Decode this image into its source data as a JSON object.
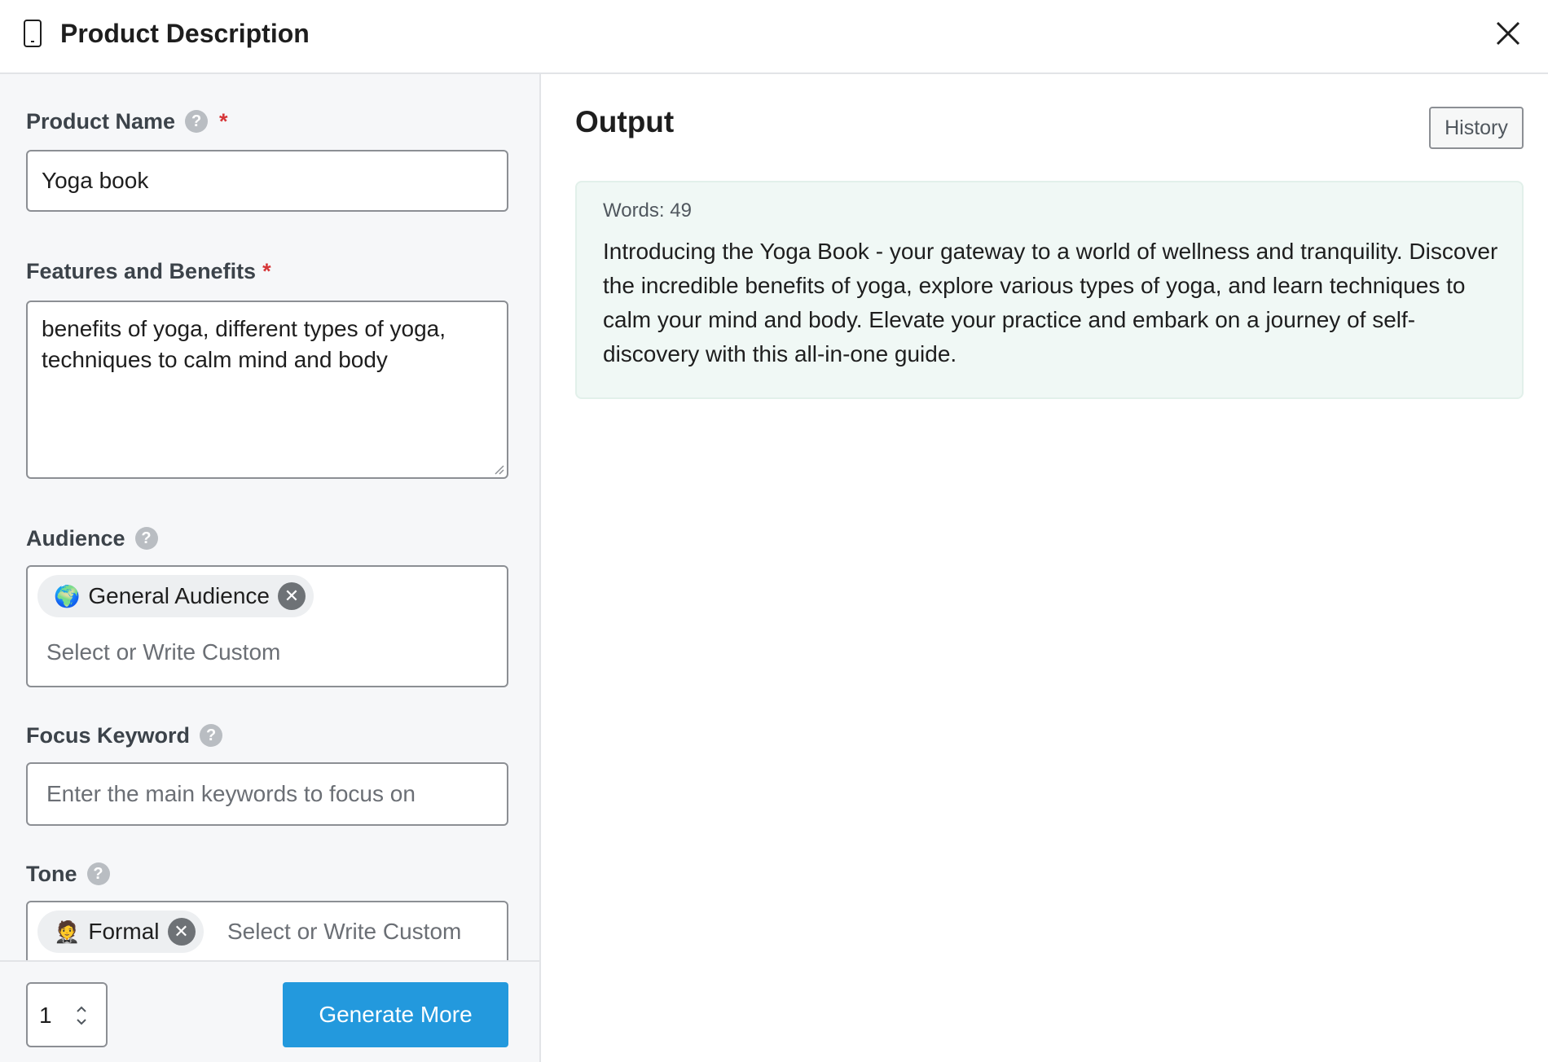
{
  "header": {
    "title": "Product Description",
    "icon": "mobile-device-icon"
  },
  "form": {
    "product_name": {
      "label": "Product Name",
      "required_mark": "*",
      "value": "Yoga book"
    },
    "features": {
      "label": "Features and Benefits",
      "required_mark": "*",
      "value": "benefits of yoga, different types of yoga, techniques to calm mind and body"
    },
    "audience": {
      "label": "Audience",
      "chip_emoji": "🌍",
      "chip_label": "General Audience",
      "placeholder": "Select or Write Custom"
    },
    "focus_keyword": {
      "label": "Focus Keyword",
      "placeholder": "Enter the main keywords to focus on"
    },
    "tone": {
      "label": "Tone",
      "chip_emoji": "🤵",
      "chip_label": "Formal",
      "placeholder": "Select or Write Custom"
    }
  },
  "footer": {
    "count_value": "1",
    "generate_label": "Generate More"
  },
  "output": {
    "title": "Output",
    "history_label": "History",
    "words_label": "Words: 49",
    "text": "Introducing the Yoga Book - your gateway to a world of wellness and tranquility. Discover the incredible benefits of yoga, explore various types of yoga, and learn techniques to calm your mind and body. Elevate your practice and embark on a journey of self-discovery with this all-in-one guide."
  },
  "colors": {
    "accent": "#2399dd",
    "required": "#d63638",
    "output_bg": "#f0f8f5"
  }
}
